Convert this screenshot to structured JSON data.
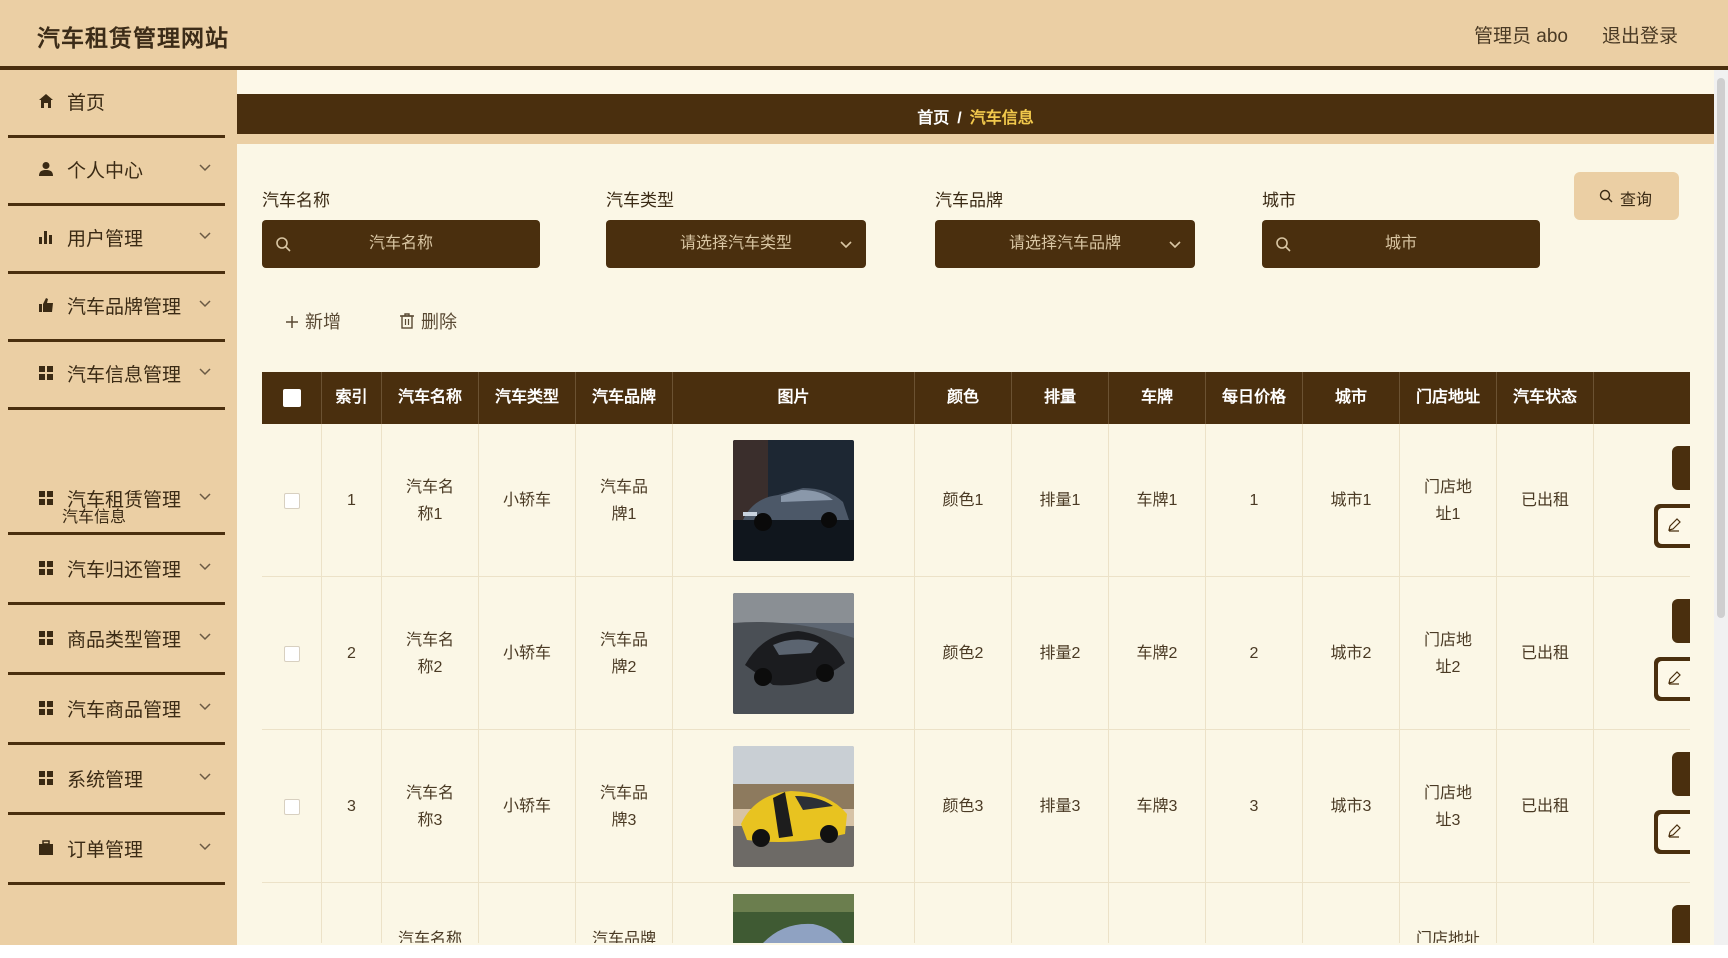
{
  "app": {
    "title": "汽车租赁管理网站",
    "user_label": "管理员 abo",
    "logout_label": "退出登录"
  },
  "sidebar": {
    "items": [
      {
        "label": "首页",
        "icon": "home-icon",
        "has_arrow": false
      },
      {
        "label": "个人中心",
        "icon": "person-icon",
        "has_arrow": true
      },
      {
        "label": "用户管理",
        "icon": "bar-chart-icon",
        "has_arrow": true
      },
      {
        "label": "汽车品牌管理",
        "icon": "thumb-icon",
        "has_arrow": true
      },
      {
        "label": "汽车信息管理",
        "icon": "grid-icon",
        "has_arrow": true
      },
      {
        "label": "汽车租赁管理",
        "icon": "grid-icon",
        "has_arrow": true
      },
      {
        "label": "汽车归还管理",
        "icon": "grid-icon",
        "has_arrow": true
      },
      {
        "label": "商品类型管理",
        "icon": "grid-icon",
        "has_arrow": true
      },
      {
        "label": "汽车商品管理",
        "icon": "grid-icon",
        "has_arrow": true
      },
      {
        "label": "系统管理",
        "icon": "grid-icon",
        "has_arrow": true
      },
      {
        "label": "订单管理",
        "icon": "briefcase-icon",
        "has_arrow": true
      }
    ],
    "submenu": {
      "label": "汽车信息"
    }
  },
  "breadcrumb": {
    "home": "首页",
    "separator": "/",
    "current": "汽车信息"
  },
  "filters": {
    "name": {
      "label": "汽车名称",
      "placeholder": "汽车名称"
    },
    "type": {
      "label": "汽车类型",
      "placeholder": "请选择汽车类型"
    },
    "brand": {
      "label": "汽车品牌",
      "placeholder": "请选择汽车品牌"
    },
    "city": {
      "label": "城市",
      "placeholder": "城市"
    },
    "query_label": "查询"
  },
  "actions": {
    "add_label": "新增",
    "delete_label": "删除"
  },
  "table": {
    "headers": [
      "索引",
      "汽车名称",
      "汽车类型",
      "汽车品牌",
      "图片",
      "颜色",
      "排量",
      "车牌",
      "每日价格",
      "城市",
      "门店地址",
      "汽车状态",
      ""
    ],
    "rows": [
      {
        "index": "1",
        "name": "汽车名称1",
        "type": "小轿车",
        "brand": "汽车品牌1",
        "image": "dark-sedan",
        "color": "颜色1",
        "displacement": "排量1",
        "plate": "车牌1",
        "price": "1",
        "city": "城市1",
        "address": "门店地址1",
        "status": "已出租"
      },
      {
        "index": "2",
        "name": "汽车名称2",
        "type": "小轿车",
        "brand": "汽车品牌2",
        "image": "black-sports-car",
        "color": "颜色2",
        "displacement": "排量2",
        "plate": "车牌2",
        "price": "2",
        "city": "城市2",
        "address": "门店地址2",
        "status": "已出租"
      },
      {
        "index": "3",
        "name": "汽车名称3",
        "type": "小轿车",
        "brand": "汽车品牌3",
        "image": "yellow-muscle-car",
        "color": "颜色3",
        "displacement": "排量3",
        "plate": "车牌3",
        "price": "3",
        "city": "城市3",
        "address": "门店地址3",
        "status": "已出租"
      }
    ],
    "partial_row": {
      "name": "汽车名称",
      "brand": "汽车品牌",
      "address": "门店地址"
    }
  },
  "colors": {
    "accent_dark": "#4a2f0e",
    "sidebar_bg": "#ebcfa4",
    "content_bg": "#fbf7e6",
    "highlight": "#f2c94c"
  }
}
